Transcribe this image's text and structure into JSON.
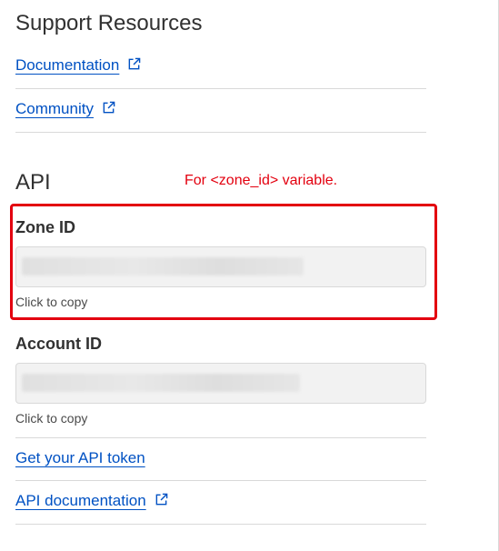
{
  "support": {
    "title": "Support Resources",
    "links": [
      {
        "label": "Documentation",
        "icon": "external-link-icon"
      },
      {
        "label": "Community",
        "icon": "external-link-icon"
      }
    ]
  },
  "api": {
    "title": "API",
    "annotation": "For <zone_id> variable.",
    "zone_id": {
      "label": "Zone ID",
      "hint": "Click to copy"
    },
    "account_id": {
      "label": "Account ID",
      "hint": "Click to copy"
    },
    "links": [
      {
        "label": "Get your API token"
      },
      {
        "label": "API documentation",
        "icon": "external-link-icon"
      }
    ]
  },
  "colors": {
    "link": "#0051c3",
    "annotation": "#e3000f",
    "text": "#313131",
    "divider": "#d9d9d9",
    "field_bg": "#f2f2f2"
  }
}
